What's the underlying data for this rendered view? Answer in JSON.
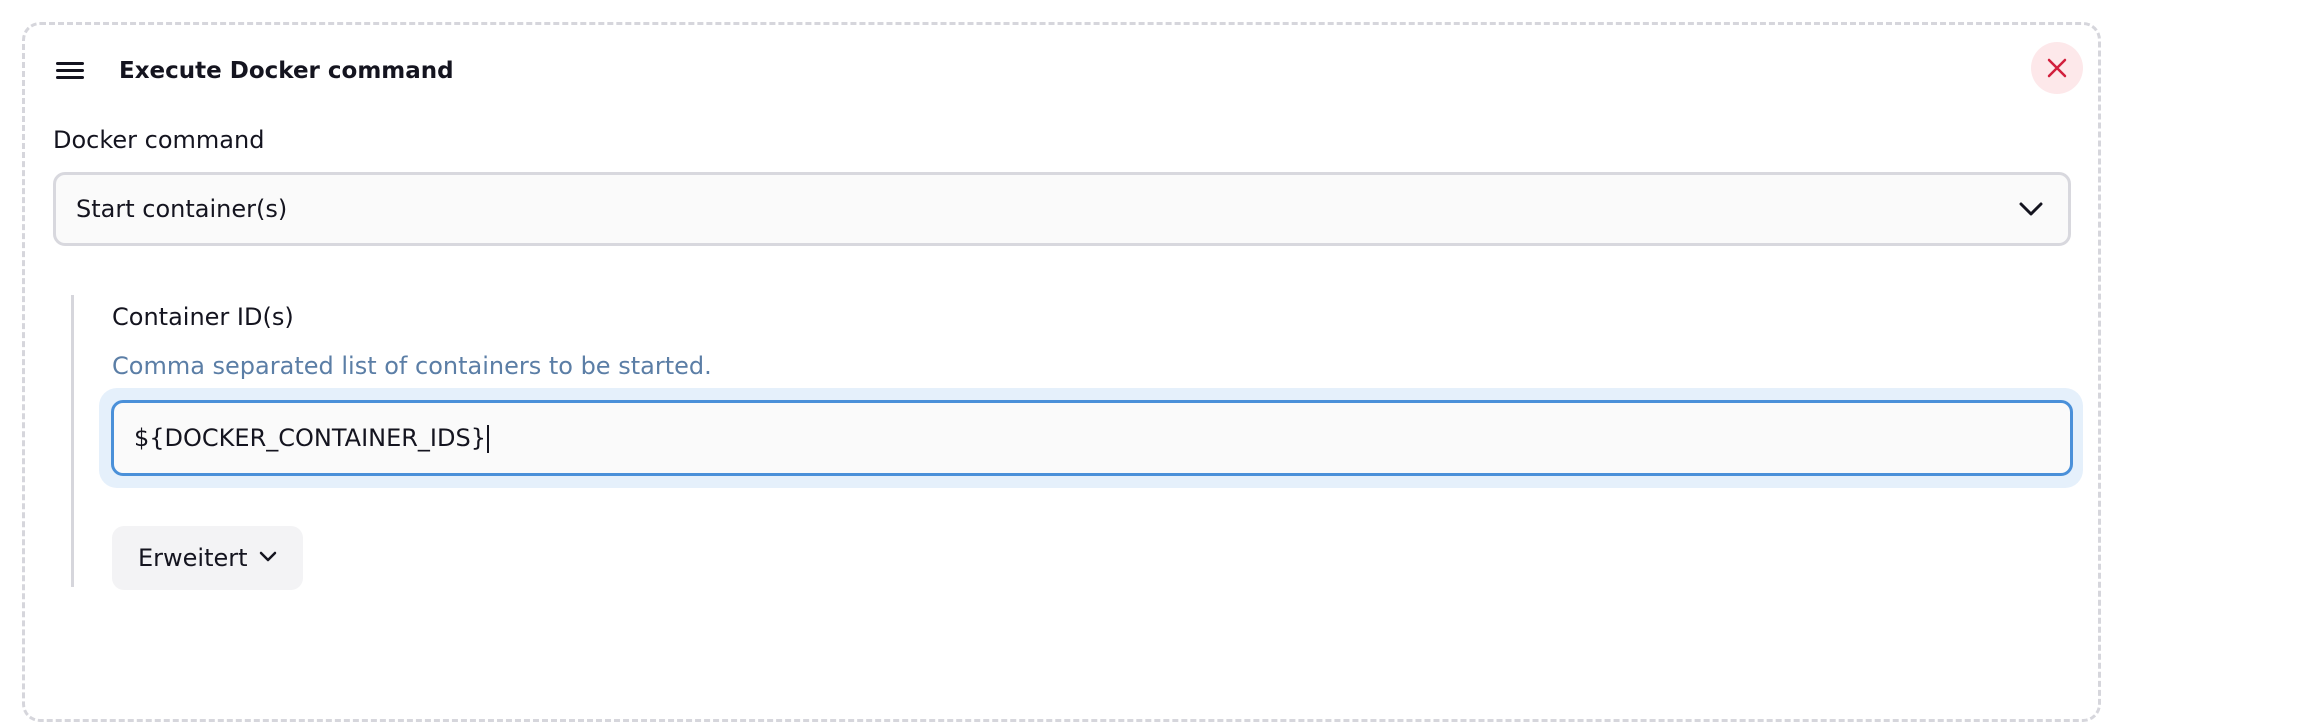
{
  "step": {
    "title": "Execute Docker command",
    "drag_icon": "hamburger-menu-icon",
    "close_icon": "close-x-icon",
    "close_color": "#d21f3c"
  },
  "docker_command": {
    "label": "Docker command",
    "selected": "Start container(s)",
    "chevron_icon": "chevron-down-icon"
  },
  "container_ids": {
    "label": "Container ID(s)",
    "help": "Comma separated list of containers to be started.",
    "value": "${DOCKER_CONTAINER_IDS}",
    "focus_color": "#4a90d9"
  },
  "advanced": {
    "label": "Erweitert",
    "chevron_icon": "chevron-down-icon"
  }
}
